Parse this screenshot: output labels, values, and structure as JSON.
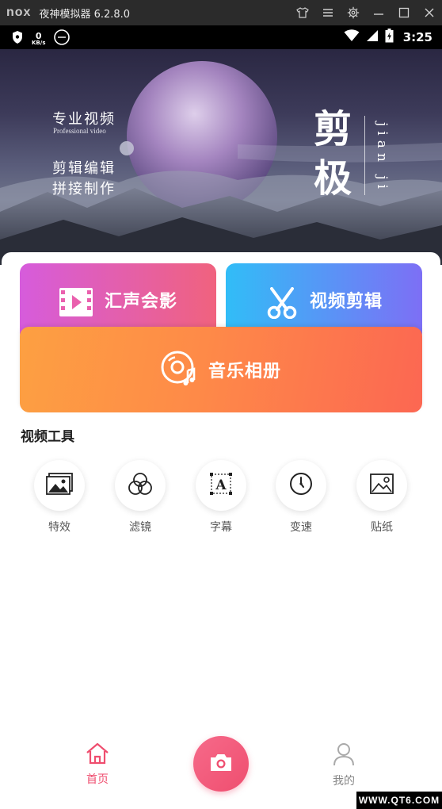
{
  "emulator": {
    "logo": "nox",
    "title": "夜神模拟器 6.2.8.0",
    "controls": [
      "shirt-icon",
      "menu-icon",
      "gear-icon",
      "minimize-icon",
      "maximize-icon",
      "close-icon"
    ]
  },
  "status_bar": {
    "speed_value": "0",
    "speed_unit": "KB/s",
    "time": "3:25"
  },
  "banner": {
    "line1": "专业视频",
    "line1_en": "Professional video",
    "line2": "剪辑编辑",
    "line3": "拼接制作",
    "brand_char1": "剪",
    "brand_char2": "极",
    "brand_pinyin": "jian ji"
  },
  "cards": {
    "card_a": "汇声会影",
    "card_b": "视频剪辑",
    "card_c": "音乐相册"
  },
  "tools": {
    "title": "视频工具",
    "items": [
      {
        "label": "特效",
        "icon": "image-stack-icon"
      },
      {
        "label": "滤镜",
        "icon": "filter-circles-icon"
      },
      {
        "label": "字幕",
        "icon": "subtitle-a-icon"
      },
      {
        "label": "变速",
        "icon": "clock-icon"
      },
      {
        "label": "贴纸",
        "icon": "sticker-image-icon"
      }
    ]
  },
  "bottom_nav": {
    "home": "首页",
    "mine": "我的",
    "active": "home"
  },
  "colors": {
    "accent_pink": "#ef4e6f",
    "card_a_start": "#d65cdc",
    "card_a_end": "#f0627e",
    "card_b_start": "#31bdf7",
    "card_b_end": "#7d6ff5",
    "card_c_start": "#fda042",
    "card_c_end": "#fc6752"
  },
  "watermark": "WWW.QT6.COM"
}
